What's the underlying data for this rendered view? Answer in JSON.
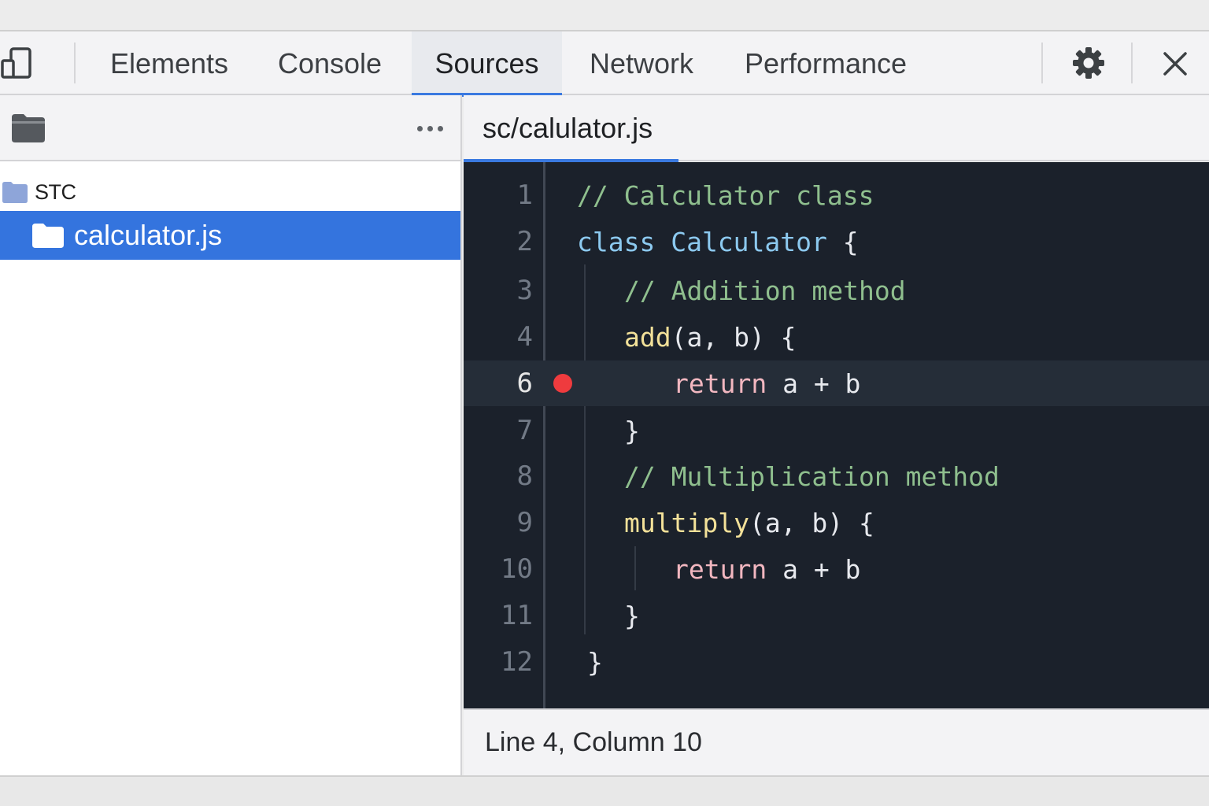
{
  "toolbar": {
    "device_toggle_icon": "device-toggle-icon",
    "tabs": [
      {
        "label": "Elements",
        "active": false
      },
      {
        "label": "Console",
        "active": false
      },
      {
        "label": "Sources",
        "active": true
      },
      {
        "label": "Network",
        "active": false
      },
      {
        "label": "Performance",
        "active": false
      }
    ],
    "settings_icon": "gear-icon",
    "close_icon": "close-icon"
  },
  "navigator": {
    "folder_icon": "folder-icon",
    "more_icon": "more-options-icon",
    "tree": {
      "folder_label": "STC",
      "file_label": "calculator.js",
      "selected": "calculator.js"
    }
  },
  "editor": {
    "tab_label": "sc/calulator.js",
    "breakpoint_line": "6",
    "lines": [
      {
        "num": "1",
        "tokens": [
          {
            "t": "// Calculator class",
            "c": "comment"
          }
        ]
      },
      {
        "num": "2",
        "tokens": [
          {
            "t": "class Calculator",
            "c": "kw"
          },
          {
            "t": " {",
            "c": "plain"
          }
        ]
      },
      {
        "num": "3",
        "tokens": [
          {
            "t": "// Addition method",
            "c": "comment"
          }
        ]
      },
      {
        "num": "4",
        "tokens": [
          {
            "t": "add",
            "c": "fn"
          },
          {
            "t": "(a, b) {",
            "c": "plain"
          }
        ]
      },
      {
        "num": "6",
        "tokens": [
          {
            "t": "return",
            "c": "ret"
          },
          {
            "t": " a + b",
            "c": "plain"
          }
        ]
      },
      {
        "num": "7",
        "tokens": [
          {
            "t": "}",
            "c": "plain"
          }
        ]
      },
      {
        "num": "8",
        "tokens": [
          {
            "t": "// Multiplication method",
            "c": "comment"
          }
        ]
      },
      {
        "num": "9",
        "tokens": [
          {
            "t": "multiply",
            "c": "fn"
          },
          {
            "t": "(a, b) {",
            "c": "plain"
          }
        ]
      },
      {
        "num": "10",
        "tokens": [
          {
            "t": "return",
            "c": "ret"
          },
          {
            "t": " a + b",
            "c": "plain"
          }
        ]
      },
      {
        "num": "11",
        "tokens": [
          {
            "t": "}",
            "c": "plain"
          }
        ]
      },
      {
        "num": "12",
        "tokens": [
          {
            "t": "}",
            "c": "plain"
          }
        ]
      }
    ]
  },
  "status": {
    "position": "Line 4, Column 10"
  },
  "colors": {
    "accent": "#3a79e0",
    "selection": "#3474de",
    "editor_bg": "#1b212b",
    "breakpoint": "#ef3b3e",
    "comment": "#8fbf8e",
    "keyword": "#8cc9ef",
    "function": "#f3e199",
    "return": "#f2b7c0"
  }
}
